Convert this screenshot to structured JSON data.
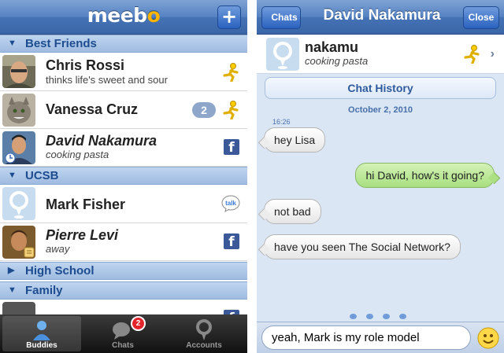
{
  "left": {
    "logo": {
      "text": "meeb",
      "o": "o"
    },
    "add_button": "+",
    "sections": [
      {
        "title": "Best Friends"
      },
      {
        "title": "UCSB"
      },
      {
        "title": "High School"
      },
      {
        "title": "Family"
      }
    ],
    "buddies": [
      {
        "name": "Chris Rossi",
        "status": "thinks life's sweet and sour",
        "service": "aim-icon"
      },
      {
        "name": "Vanessa Cruz",
        "status": "",
        "unread": "2",
        "service": "aim-icon"
      },
      {
        "name": "David Nakamura",
        "status": "cooking pasta",
        "service": "facebook-icon"
      },
      {
        "name": "Mark Fisher",
        "status": "",
        "service": "gtalk-icon"
      },
      {
        "name": "Pierre Levi",
        "status": "away",
        "service": "facebook-icon"
      }
    ],
    "tabs": [
      {
        "label": "Buddies",
        "icon": "buddies-icon"
      },
      {
        "label": "Chats",
        "icon": "chats-icon",
        "badge": "2"
      },
      {
        "label": "Accounts",
        "icon": "accounts-icon"
      }
    ]
  },
  "right": {
    "back_label": "Chats",
    "title": "David Nakamura",
    "close_label": "Close",
    "contact": {
      "handle": "nakamu",
      "status": "cooking pasta",
      "service": "aim-icon"
    },
    "history_label": "Chat History",
    "date": "October 2, 2010",
    "time": "16:26",
    "messages": [
      {
        "from": "them",
        "text": "hey Lisa"
      },
      {
        "from": "me",
        "text": "hi David, how's it going?"
      },
      {
        "from": "them",
        "text": "not bad"
      },
      {
        "from": "them",
        "text": "have you seen The Social Network?"
      }
    ],
    "input_value": "yeah, Mark is my role model",
    "emoji_icon": "smiley-icon"
  },
  "colors": {
    "nav_blue": "#4673b5",
    "section_blue": "#bfd5ef",
    "out_bubble": "#a8df80",
    "aim_yellow": "#ffcc00",
    "facebook": "#3b5998"
  }
}
